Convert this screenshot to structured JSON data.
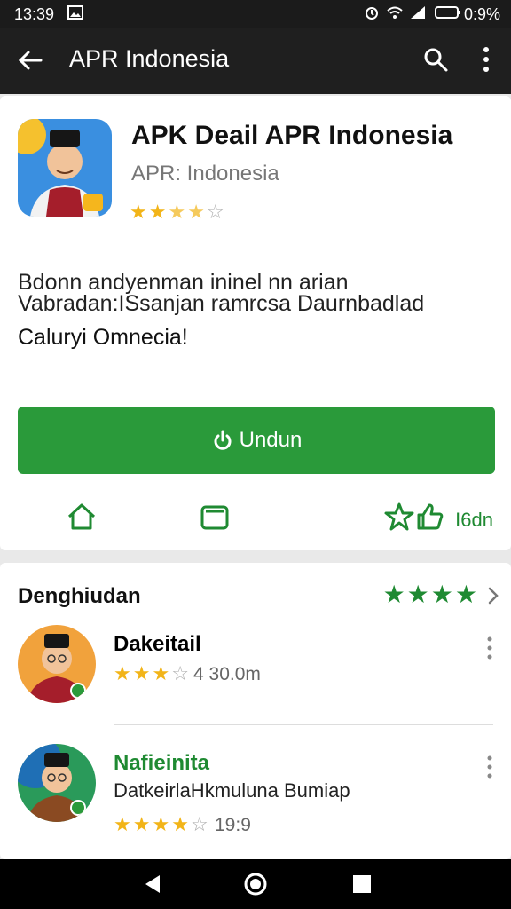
{
  "status_bar": {
    "time": "13:39",
    "battery_text": "0:9%",
    "icons": [
      "gallery-icon",
      "alarm-icon",
      "wifi-icon",
      "signal-icon",
      "battery-icon"
    ]
  },
  "app_bar": {
    "title": "APR Indonesia",
    "icons": [
      "back-arrow-icon",
      "search-icon",
      "more-vert-icon"
    ]
  },
  "app": {
    "name": "APK Deail APR Indonesia",
    "developer": "APR: Indonesia",
    "rating_stars": 2.5,
    "description_line1": "Bdonn andyenman ininel nn arian",
    "description_line2": "Vabradan:ISsanjan ramrcsa Daurnbadlad",
    "description_line3": "Caluryi Omnecia!",
    "install_label": "Undun",
    "accent_color": "#2a9a3a"
  },
  "actions": {
    "icons": [
      "home-icon",
      "card-icon",
      "star-outline-icon",
      "thumbs-up-icon"
    ],
    "share_label": "I6dn"
  },
  "reviews_section": {
    "title": "Denghiudan",
    "overall_stars": 4,
    "items": [
      {
        "name": "Dakeitail",
        "name_color": "#111111",
        "text": "",
        "stars": 3,
        "meta": "4 30.0m"
      },
      {
        "name": "Nafieinita",
        "name_color": "#1f8a32",
        "text": "DatkeirlaHkmuluna Bumiap",
        "stars": 4,
        "meta": "19:9"
      }
    ]
  },
  "nav_bar": {
    "icons": [
      "back-triangle-icon",
      "home-circle-icon",
      "recents-square-icon"
    ]
  }
}
